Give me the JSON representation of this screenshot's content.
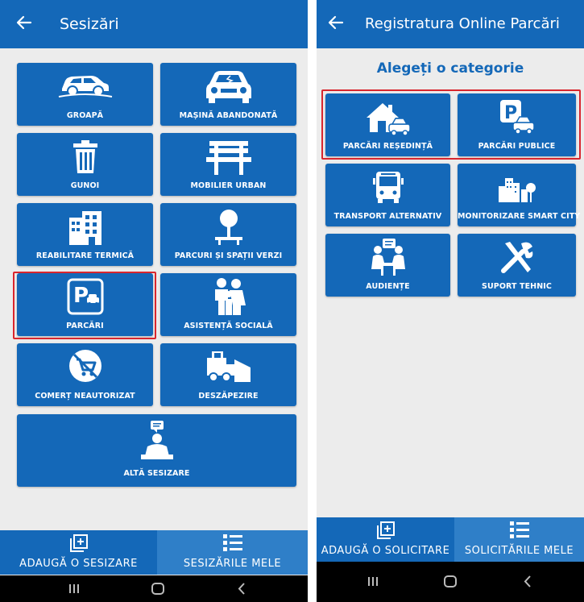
{
  "left_screen": {
    "title": "Sesizări",
    "tiles": [
      {
        "label": "GROAPĂ",
        "icon": "car-icon"
      },
      {
        "label": "MAȘINĂ ABANDONATĂ",
        "icon": "wrecked-car-icon"
      },
      {
        "label": "GUNOI",
        "icon": "trash-icon"
      },
      {
        "label": "MOBILIER URBAN",
        "icon": "bench-icon"
      },
      {
        "label": "REABILITARE TERMICĂ",
        "icon": "building-icon"
      },
      {
        "label": "PARCURI ȘI SPAȚII VERZI",
        "icon": "tree-icon"
      },
      {
        "label": "PARCĂRI",
        "icon": "parking-icon"
      },
      {
        "label": "ASISTENȚĂ SOCIALĂ",
        "icon": "family-icon"
      },
      {
        "label": "COMERȚ NEAUTORIZAT",
        "icon": "no-cart-icon"
      },
      {
        "label": "DESZĂPEZIRE",
        "icon": "snowplow-icon"
      },
      {
        "label": "ALTĂ SESIZARE",
        "icon": "speaker-icon"
      }
    ],
    "nav": {
      "add_label": "ADAUGĂ O SESIZARE",
      "list_label": "SESIZĂRILE MELE"
    }
  },
  "right_screen": {
    "title": "Registratura Online Parcări",
    "subtitle": "Alegeți o categorie",
    "tiles": [
      {
        "label": "PARCĂRI REȘEDINȚĂ",
        "icon": "house-car-icon"
      },
      {
        "label": "PARCĂRI PUBLICE",
        "icon": "parking-car-icon"
      },
      {
        "label": "TRANSPORT ALTERNATIV",
        "icon": "bus-icon"
      },
      {
        "label": "MONITORIZARE SMART CITY",
        "icon": "city-icon"
      },
      {
        "label": "AUDIENȚE",
        "icon": "meeting-icon"
      },
      {
        "label": "SUPORT TEHNIC",
        "icon": "tools-icon"
      }
    ],
    "nav": {
      "add_label": "ADAUGĂ O SOLICITARE",
      "list_label": "SOLICITĂRILE MELE"
    }
  },
  "colors": {
    "primary": "#1468b8",
    "active_tab": "#2f7fc8",
    "highlight": "#d8262e",
    "background": "#ececec"
  }
}
